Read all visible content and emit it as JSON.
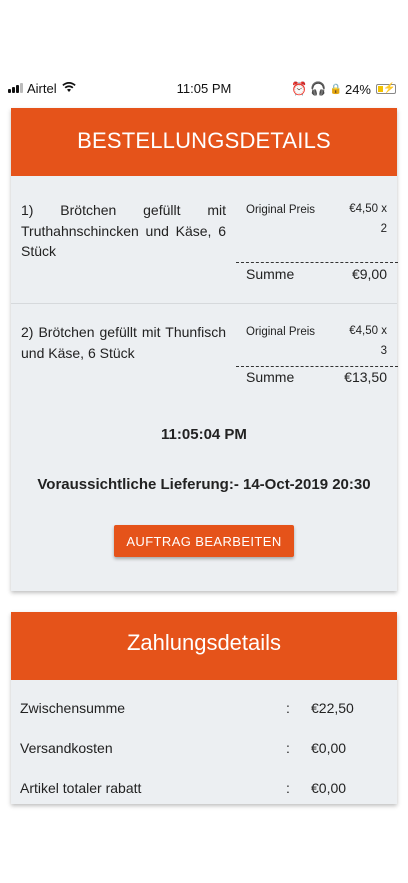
{
  "status_bar": {
    "carrier": "Airtel",
    "time": "11:05 PM",
    "battery": "24%"
  },
  "order": {
    "title": "BESTELLUNGSDETAILS",
    "items": [
      {
        "name": "1) Brötchen gefüllt mit Truthahnschincken und Käse, 6 Stück",
        "original_label": "Original Preis",
        "unit_price": "€4,50 x",
        "qty": "2",
        "sum_label": "Summe",
        "sum_value": "€9,00"
      },
      {
        "name": "2) Brötchen gefüllt mit Thunfisch und Käse, 6 Stück",
        "original_label": "Original Preis",
        "unit_price": "€4,50 x",
        "qty": "3",
        "sum_label": "Summe",
        "sum_value": "€13,50"
      }
    ],
    "order_time": "11:05:04 PM",
    "delivery_label": "Voraussichtliche Lieferung:-",
    "delivery_value": "14-Oct-2019 20:30",
    "edit_button": "AUFTRAG BEARBEITEN"
  },
  "payment": {
    "title": "Zahlungsdetails",
    "rows": [
      {
        "label": "Zwischensumme",
        "colon": ":",
        "value": "€22,50"
      },
      {
        "label": "Versandkosten",
        "colon": ":",
        "value": "€0,00"
      },
      {
        "label": "Artikel totaler rabatt",
        "colon": ":",
        "value": "€0,00"
      }
    ]
  },
  "colors": {
    "accent": "#e5531a",
    "card_bg": "#eceff2"
  },
  "icons": [
    "signal-icon",
    "wifi-icon",
    "alarm-icon",
    "headphones-icon",
    "lock-icon",
    "battery-icon"
  ]
}
